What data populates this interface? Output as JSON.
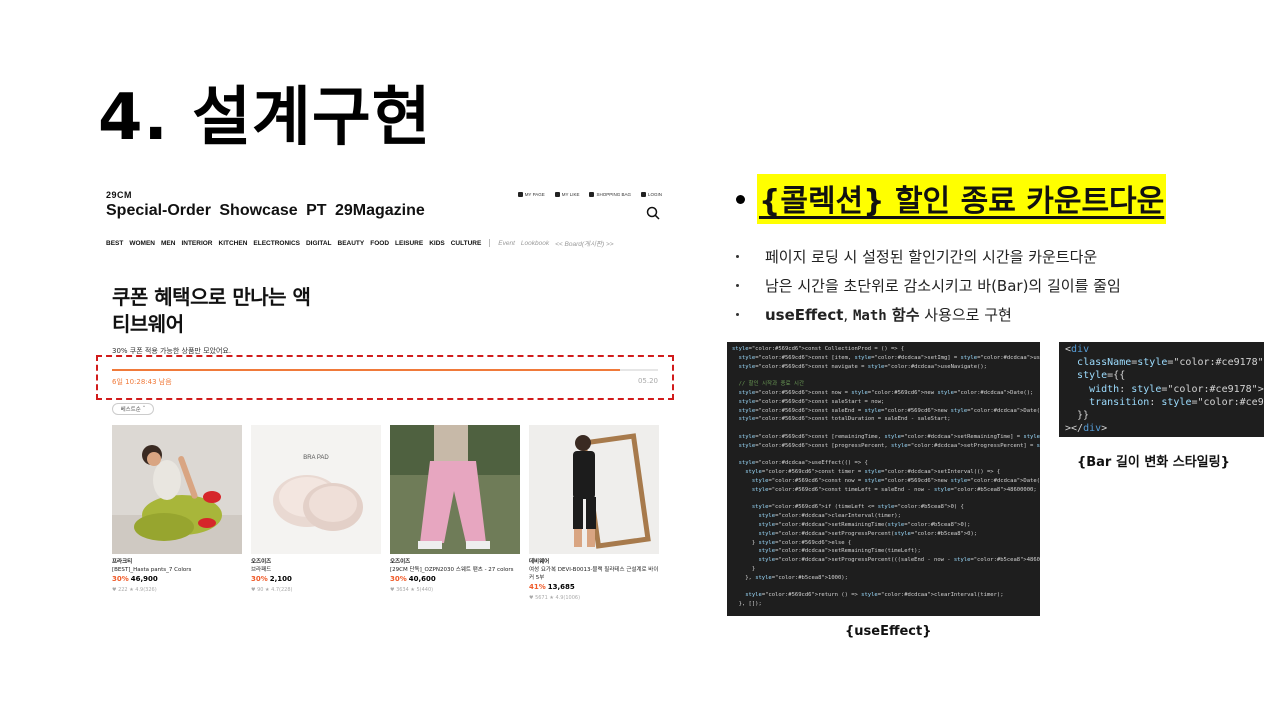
{
  "slide": {
    "title": "4. 설계구현",
    "section_heading": "{콜렉션} 할인 종료 카운트다운",
    "bullets": [
      "페이지 로딩 시 설정된 할인기간의 시간을 카운트다운",
      "남은 시간을 초단위로 감소시키고 바(Bar)의 길이를 줄임"
    ],
    "bullet3": {
      "a": "useEffect",
      "b": ", ",
      "c": "Math",
      "d": " 함수",
      "e": " 사용으로 구현"
    },
    "caption_code": "{useEffect}",
    "caption_style": "{Bar 길이 변화 스타일링}"
  },
  "site": {
    "brand": "29CM",
    "title": "Special-Order  Showcase  PT  29Magazine",
    "util": [
      "MY PAGE",
      "MY LIKE",
      "SHOPPING BAG",
      "LOGIN"
    ],
    "nav": [
      "BEST",
      "WOMEN",
      "MEN",
      "INTERIOR",
      "KITCHEN",
      "ELECTRONICS",
      "DIGITAL",
      "BEAUTY",
      "FOOD",
      "LEISURE",
      "KIDS",
      "CULTURE"
    ],
    "nav_extra": [
      "Event",
      "Lookbook",
      "<< Board(게시판) >>"
    ],
    "hero_line1": "쿠폰 혜택으로 만나는 액",
    "hero_line2": "티브웨어",
    "hero_sub": "30% 쿠폰 적용 가능한 상품만 모았어요.",
    "remaining": "6일 10:28:43 남음",
    "end_date": "05.20",
    "progress": 0.93,
    "sort_label": "베스트순",
    "products": [
      {
        "brand": "프라크티",
        "name": "[BEST]_Hasta pants_7 Colors",
        "discount": "30%",
        "price": "46,900",
        "meta": "♥ 222  ★ 4.9(326)"
      },
      {
        "brand": "오즈이즈",
        "name": "브라패드",
        "discount": "30%",
        "price": "2,100",
        "meta": "♥ 90  ★ 4.7(228)"
      },
      {
        "brand": "오즈이즈",
        "name": "[29CM 단독]_OZPN2030 스웨트 팬츠 - 27 colors",
        "discount": "30%",
        "price": "40,600",
        "meta": "♥ 3634  ★ 5(440)"
      },
      {
        "brand": "데비웨어",
        "name": "여성 요가복 DEVI-B0013-블랙 필라테스 근설계로 바이커 5부",
        "discount": "41%",
        "price": "13,685",
        "meta": "♥ 5671  ★ 4.9(1006)"
      }
    ],
    "bra_pad_label": "BRA PAD"
  },
  "code_effect": [
    "const CollectionProd = () => {",
    "  const [item, setImg] = useState(data);",
    "  const navigate = useNavigate();",
    "",
    "  // 할인 시작과 종료 시간",
    "  const now = new Date();",
    "  const saleStart = now;",
    "  const saleEnd = new Date(now.getTime() + 7 * 24 * 60 * 60 * 1000);",
    "  const totalDuration = saleEnd - saleStart;",
    "",
    "  const [remainingTime, setRemainingTime] = useState(saleEnd - new Date());",
    "  const [progressPercent, setProgressPercent] = useState(100);",
    "",
    "  useEffect(() => {",
    "    const timer = setInterval(() => {",
    "      const now = new Date();",
    "      const timeLeft = saleEnd - now - 48600000;",
    "",
    "      if (timeLeft <= 0) {",
    "        clearInterval(timer);",
    "        setRemainingTime(0);",
    "        setProgressPercent(0);",
    "      } else {",
    "        setRemainingTime(timeLeft);",
    "        setProgressPercent(((saleEnd - now - 48600000) / totalDuration) * 100);",
    "      }",
    "    }, 1000);",
    "",
    "    return () => clearInterval(timer);",
    "  }, []);"
  ],
  "code_style": [
    "<div",
    "  className=\"time-bar\"",
    "  style={{",
    "    width: `${progressPercent}%`,",
    "    transition: \"width 1s linear\",",
    "  }}",
    "></div>"
  ],
  "colors": {
    "accent": "#f07a3a",
    "highlight": "#ffff00",
    "dashed_box": "#d11b1b",
    "code_bg": "#1e1e1e"
  }
}
